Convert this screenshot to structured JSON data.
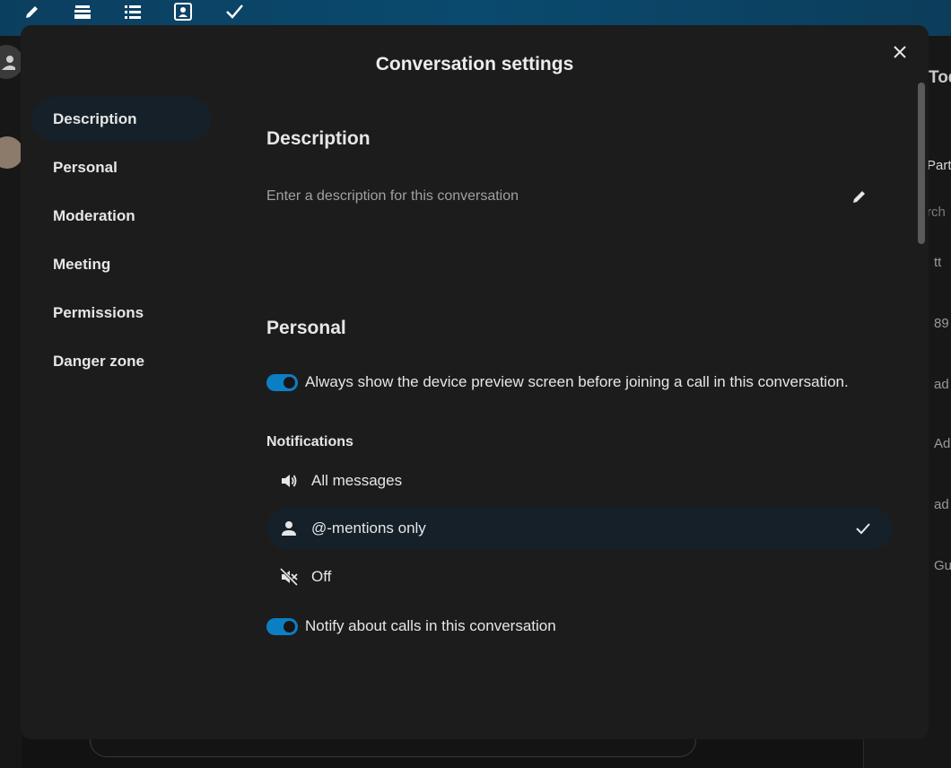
{
  "modal": {
    "title": "Conversation settings"
  },
  "nav": {
    "items": [
      {
        "label": "Description"
      },
      {
        "label": "Personal"
      },
      {
        "label": "Moderation"
      },
      {
        "label": "Meeting"
      },
      {
        "label": "Permissions"
      },
      {
        "label": "Danger zone"
      }
    ],
    "active": "Description"
  },
  "description": {
    "title": "Description",
    "placeholder": "Enter a description for this conversation"
  },
  "personal": {
    "title": "Personal",
    "device_preview_label": "Always show the device preview screen before joining a call in this conversation.",
    "device_preview_enabled": true,
    "notifications_heading": "Notifications",
    "notification_options": [
      {
        "label": "All messages",
        "icon": "volume-icon"
      },
      {
        "label": "@-mentions only",
        "icon": "person-icon",
        "selected": true
      },
      {
        "label": "Off",
        "icon": "volume-off-icon"
      }
    ],
    "notify_calls_label": "Notify about calls in this conversation",
    "notify_calls_enabled": true
  },
  "background": {
    "right_texts": [
      "Tod",
      "Part",
      "rch",
      "tt",
      "89",
      "ad",
      "Ad",
      "ad",
      "Gu"
    ]
  },
  "colors": {
    "accent": "#0c7fc3",
    "modal_bg": "#1c1c1d",
    "selected_bg": "#152028",
    "topbar": "#0a4a6e"
  }
}
